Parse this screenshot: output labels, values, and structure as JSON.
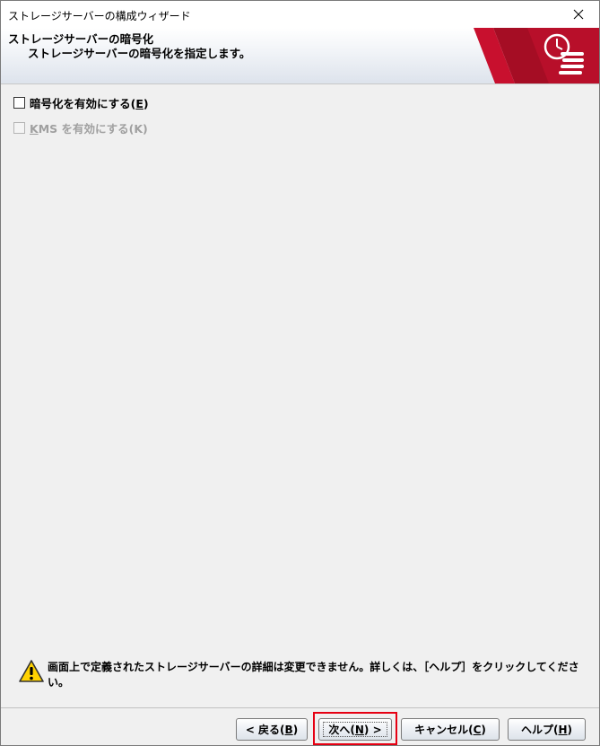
{
  "window": {
    "title": "ストレージサーバーの構成ウィザード"
  },
  "header": {
    "title": "ストレージサーバーの暗号化",
    "subtitle": "ストレージサーバーの暗号化を指定します。"
  },
  "options": {
    "enable_encryption": {
      "label_prefix": "暗号化を有効にする(",
      "mnemonic": "E",
      "label_suffix": ")",
      "checked": false,
      "enabled": true
    },
    "enable_kms": {
      "label_prefix_mnemonic": "K",
      "label_rest": "MS を有効にする(K)",
      "checked": false,
      "enabled": false
    }
  },
  "notice": {
    "icon": "warning-icon",
    "text": "画面上で定義されたストレージサーバーの詳細は変更できません。詳しくは、［ヘルプ］をクリックしてください。"
  },
  "buttons": {
    "back": {
      "prefix": "< 戻る(",
      "mnemonic": "B",
      "suffix": ")"
    },
    "next": {
      "prefix": "次へ(",
      "mnemonic": "N",
      "suffix": ") >"
    },
    "cancel": {
      "prefix": "キャンセル(",
      "mnemonic": "C",
      "suffix": ")"
    },
    "help": {
      "prefix": "ヘルプ(",
      "mnemonic": "H",
      "suffix": ")"
    }
  },
  "colors": {
    "highlight": "#e60012",
    "banner_red": "#c8102e"
  }
}
